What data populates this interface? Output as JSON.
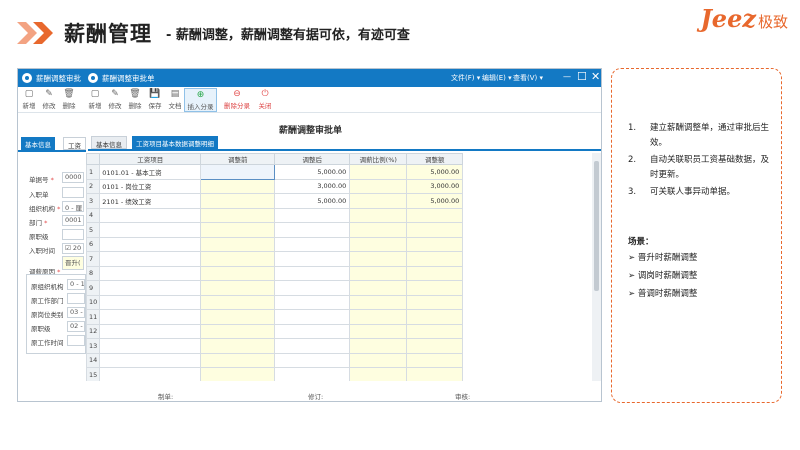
{
  "header": {
    "title": "薪酬管理",
    "subtitle": "- 薪酬调整，薪酬调整有据可依，有迹可查",
    "logo_text": "Jeez",
    "logo_cn": "极致",
    "accent": "#e8682d"
  },
  "window": {
    "bg_title": "薪酬调整审批",
    "title": "薪酬调整审批单",
    "menu": [
      "文件(F) ▾",
      "编辑(E) ▾",
      "查看(V) ▾"
    ],
    "controls": {
      "minimize": "—",
      "maximize": "☐",
      "close": "✕"
    },
    "titlebar_color": "#1379c4"
  },
  "toolbar": {
    "back": [
      {
        "label": "新增",
        "icon": "new-doc-icon",
        "glyph": "▢"
      },
      {
        "label": "修改",
        "icon": "edit-icon",
        "glyph": "✎"
      },
      {
        "label": "删除",
        "icon": "trash-icon",
        "glyph": "🗑"
      }
    ],
    "front": [
      {
        "label": "新增",
        "icon": "new-doc-icon",
        "glyph": "▢"
      },
      {
        "label": "修改",
        "icon": "edit-icon",
        "glyph": "✎"
      },
      {
        "label": "删除",
        "icon": "trash-icon",
        "glyph": "🗑"
      },
      {
        "label": "保存",
        "icon": "save-icon",
        "glyph": "💾"
      },
      {
        "label": "文档",
        "icon": "document-icon",
        "glyph": "▤"
      },
      {
        "label": "插入分录",
        "icon": "insert-row-icon",
        "glyph": "⊕"
      },
      {
        "label": "删除分录",
        "icon": "delete-row-icon",
        "glyph": "⊖"
      },
      {
        "label": "关闭",
        "icon": "power-icon",
        "glyph": "⏻"
      }
    ]
  },
  "form_title": "薪酬调整审批单",
  "back_form": {
    "tabs": [
      "基本信息",
      "工资"
    ],
    "fields": [
      {
        "label": "单据号",
        "required": true,
        "value": "0000"
      },
      {
        "label": "入职单",
        "required": false,
        "value": ""
      },
      {
        "label": "组织机构",
        "required": true,
        "value": "0 - 厘"
      },
      {
        "label": "部门",
        "required": true,
        "value": "0001"
      },
      {
        "label": "原职级",
        "required": false,
        "value": ""
      },
      {
        "label": "入职时间",
        "required": false,
        "value": "☑ 20"
      }
    ],
    "reason_label": "调薪原因",
    "reason_value": "晋升(",
    "group": [
      {
        "label": "原组织机构",
        "value": "0 - 1"
      },
      {
        "label": "原工作部门",
        "value": ""
      },
      {
        "label": "原岗位类别",
        "value": "03 -"
      },
      {
        "label": "原职级",
        "value": "02 -"
      },
      {
        "label": "原工作时间",
        "value": ""
      }
    ]
  },
  "tabs": [
    "基本信息",
    "工资项目基本数据调整明细"
  ],
  "grid": {
    "columns": [
      "",
      "工资项目",
      "调整前",
      "调整后",
      "调薪比例(%)",
      "调整额"
    ],
    "rows": [
      {
        "n": "1",
        "item": "0101.01 - 基本工资",
        "before": "",
        "after": "5,000.00",
        "ratio": "",
        "amount": "5,000.00"
      },
      {
        "n": "2",
        "item": "0101 - 岗位工资",
        "before": "",
        "after": "3,000.00",
        "ratio": "",
        "amount": "3,000.00"
      },
      {
        "n": "3",
        "item": "2101 - 绩效工资",
        "before": "",
        "after": "5,000.00",
        "ratio": "",
        "amount": "5,000.00"
      },
      {
        "n": "4",
        "item": "",
        "before": "",
        "after": "",
        "ratio": "",
        "amount": ""
      },
      {
        "n": "5",
        "item": "",
        "before": "",
        "after": "",
        "ratio": "",
        "amount": ""
      },
      {
        "n": "6",
        "item": "",
        "before": "",
        "after": "",
        "ratio": "",
        "amount": ""
      },
      {
        "n": "7",
        "item": "",
        "before": "",
        "after": "",
        "ratio": "",
        "amount": ""
      },
      {
        "n": "8",
        "item": "",
        "before": "",
        "after": "",
        "ratio": "",
        "amount": ""
      },
      {
        "n": "9",
        "item": "",
        "before": "",
        "after": "",
        "ratio": "",
        "amount": ""
      },
      {
        "n": "10",
        "item": "",
        "before": "",
        "after": "",
        "ratio": "",
        "amount": ""
      },
      {
        "n": "11",
        "item": "",
        "before": "",
        "after": "",
        "ratio": "",
        "amount": ""
      },
      {
        "n": "12",
        "item": "",
        "before": "",
        "after": "",
        "ratio": "",
        "amount": ""
      },
      {
        "n": "13",
        "item": "",
        "before": "",
        "after": "",
        "ratio": "",
        "amount": ""
      },
      {
        "n": "14",
        "item": "",
        "before": "",
        "after": "",
        "ratio": "",
        "amount": ""
      },
      {
        "n": "15",
        "item": "",
        "before": "",
        "after": "",
        "ratio": "",
        "amount": ""
      }
    ]
  },
  "footer": {
    "maker": "制单:",
    "reviser": "修订:",
    "auditor": "审核:"
  },
  "notes": {
    "items": [
      "建立薪酬调整单，通过审批后生效。",
      "自动关联职员工资基础数据，及时更新。",
      "可关联人事异动单据。"
    ],
    "scene_title": "场景：",
    "scenes": [
      "晋升时薪酬调整",
      "调岗时薪酬调整",
      "普调时薪酬调整"
    ]
  }
}
